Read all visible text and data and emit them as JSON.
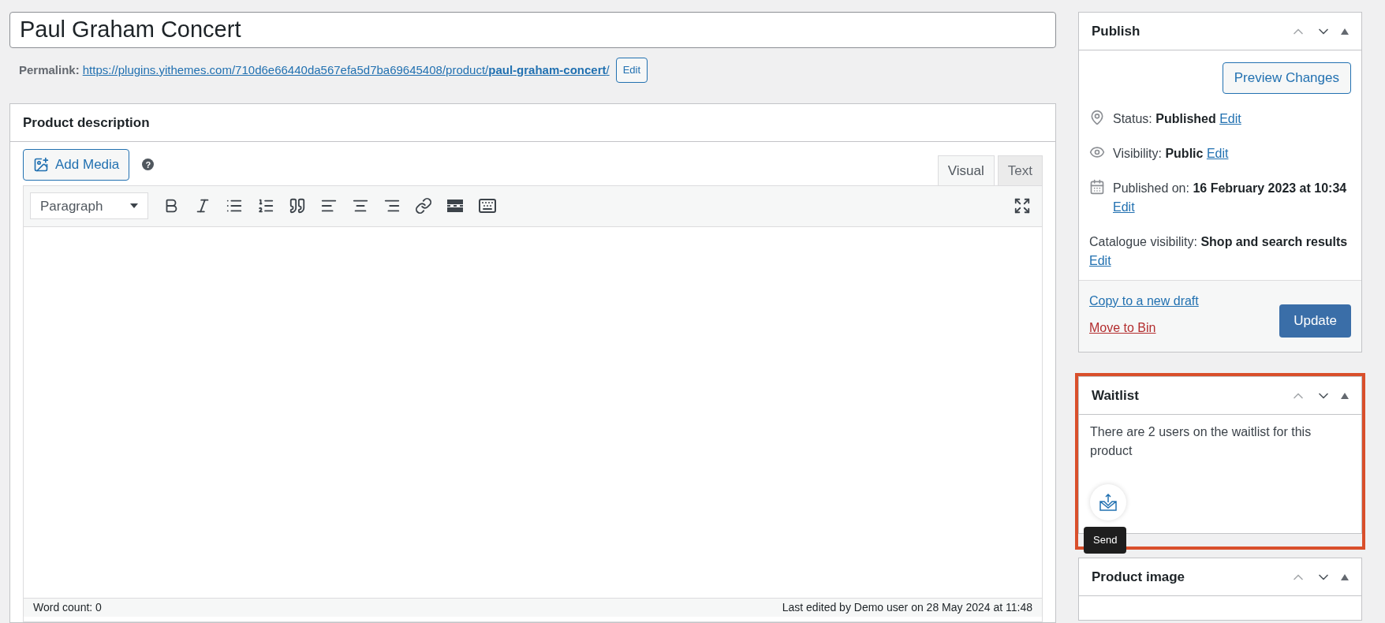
{
  "title": {
    "value": "Paul Graham Concert"
  },
  "permalink": {
    "label": "Permalink:",
    "url": "https://plugins.yithemes.com/710d6e66440da567efa5d7ba69645408/product/",
    "slug": "paul-graham-concert",
    "trail": "/",
    "edit": "Edit"
  },
  "description": {
    "title": "Product description",
    "add_media": "Add Media",
    "help": "?",
    "tabs": [
      {
        "label": "Visual",
        "selected": true
      },
      {
        "label": "Text",
        "selected": false
      }
    ],
    "format": "Paragraph",
    "word_count": "Word count: 0",
    "last_edited": "Last edited by Demo user on 28 May 2024 at 11:48"
  },
  "publish": {
    "title": "Publish",
    "preview": "Preview Changes",
    "rows": [
      {
        "kind": "pin",
        "label": "Status:",
        "value": "Published",
        "edit": "Edit"
      },
      {
        "kind": "eye",
        "label": "Visibility:",
        "value": "Public",
        "edit": "Edit"
      },
      {
        "kind": "calendar",
        "label": "Published on:",
        "value": "16 February 2023 at 10:34",
        "edit": "Edit"
      },
      {
        "kind": "plain",
        "label": "Catalogue visibility:",
        "value": "Shop and search results",
        "edit": "Edit"
      }
    ],
    "copy": "Copy to a new draft",
    "bin": "Move to Bin",
    "update": "Update"
  },
  "waitlist": {
    "title": "Waitlist",
    "highlighted": true,
    "text": "There are 2 users on the waitlist for this product",
    "tooltip": "Send"
  },
  "product_image": {
    "title": "Product image"
  }
}
